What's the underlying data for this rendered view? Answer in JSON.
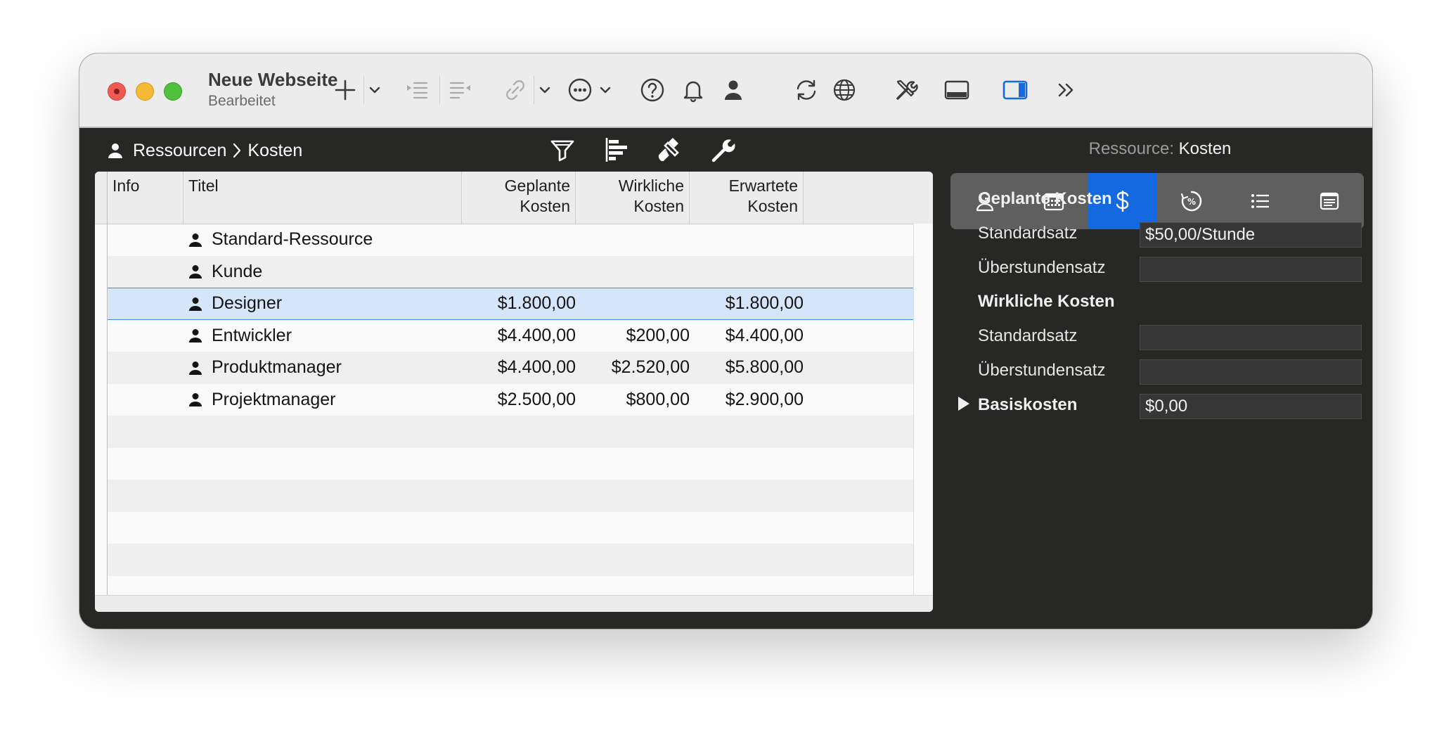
{
  "window": {
    "title": "Neue Webseite",
    "subtitle": "Bearbeitet"
  },
  "toolbar": {
    "icons": [
      "add-icon",
      "chevron-down-icon",
      "indent-icon",
      "outdent-icon",
      "link-icon",
      "chevron-down-icon",
      "more-icon",
      "chevron-down-icon",
      "help-icon",
      "bell-icon",
      "person-icon",
      "sync-icon",
      "globe-icon",
      "tools-icon",
      "bottom-panel-icon",
      "sidebar-icon",
      "overflow-icon"
    ]
  },
  "breadcrumb": {
    "root": "Ressourcen",
    "current": "Kosten"
  },
  "table": {
    "columns": [
      {
        "label": "Info"
      },
      {
        "label": "Titel"
      },
      {
        "label": "Geplante\nKosten"
      },
      {
        "label": "Wirkliche\nKosten"
      },
      {
        "label": "Erwartete\nKosten"
      }
    ],
    "rows": [
      {
        "title": "Standard-Ressource",
        "planned": "",
        "actual": "",
        "expected": ""
      },
      {
        "title": "Kunde",
        "planned": "",
        "actual": "",
        "expected": ""
      },
      {
        "title": "Designer",
        "planned": "$1.800,00",
        "actual": "",
        "expected": "$1.800,00",
        "selected": true
      },
      {
        "title": "Entwickler",
        "planned": "$4.400,00",
        "actual": "$200,00",
        "expected": "$4.400,00"
      },
      {
        "title": "Produktmanager",
        "planned": "$4.400,00",
        "actual": "$2.520,00",
        "expected": "$5.800,00"
      },
      {
        "title": "Projektmanager",
        "planned": "$2.500,00",
        "actual": "$800,00",
        "expected": "$2.900,00"
      }
    ]
  },
  "inspector": {
    "title_label": "Ressource:",
    "title_value": "Kosten",
    "tabs": [
      "person-icon",
      "calendar-icon",
      "dollar-icon",
      "progress-percent-icon",
      "list-icon",
      "notes-icon"
    ],
    "active_tab": 2,
    "planned_section": "Geplante Kosten",
    "planned_standard_label": "Standardsatz",
    "planned_standard_value": "$50,00/Stunde",
    "planned_overtime_label": "Überstundensatz",
    "planned_overtime_value": "",
    "actual_section": "Wirkliche Kosten",
    "actual_standard_label": "Standardsatz",
    "actual_standard_value": "",
    "actual_overtime_label": "Überstundensatz",
    "actual_overtime_value": "",
    "base_cost_label": "Basiskosten",
    "base_cost_value": "$0,00"
  },
  "colors": {
    "accent": "#1468e0",
    "selection": "#d6e6fa",
    "inspector_bg": "#272826"
  }
}
